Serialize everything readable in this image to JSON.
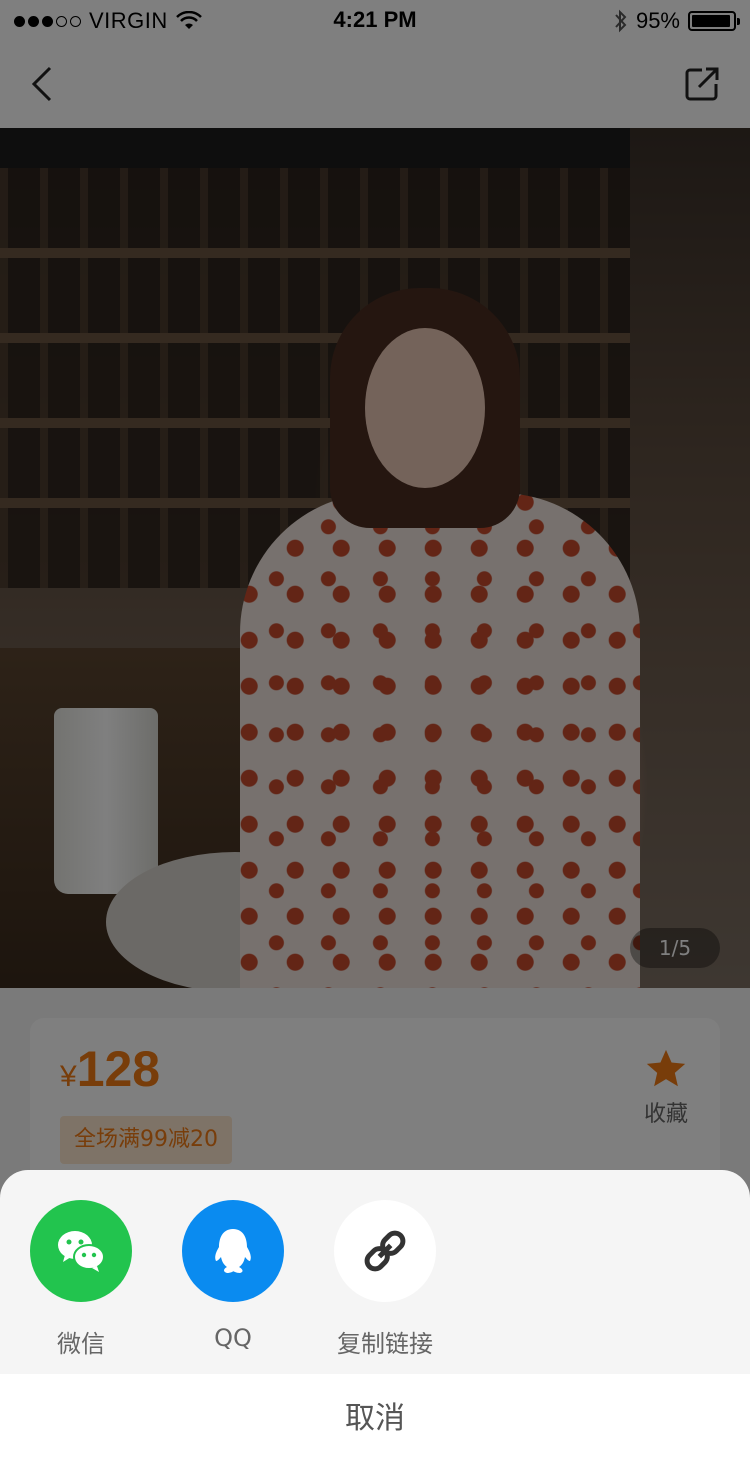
{
  "status_bar": {
    "carrier": "VIRGIN",
    "time": "4:21 PM",
    "battery": "95%",
    "battery_level": 0.95
  },
  "nav": {
    "back_icon": "chevron-left-icon",
    "share_icon": "share-external-icon"
  },
  "product": {
    "image_counter": "1/5",
    "price_symbol": "¥",
    "price": "128",
    "promo": "全场满99减20",
    "favorite_label": "收藏",
    "accent_color": "#f07a14"
  },
  "share_sheet": {
    "options": [
      {
        "label": "微信",
        "icon": "wechat-icon",
        "color": "#22c44e"
      },
      {
        "label": "QQ",
        "icon": "qq-icon",
        "color": "#0a8bf0"
      },
      {
        "label": "复制链接",
        "icon": "link-icon",
        "color": "#ffffff"
      }
    ],
    "cancel_label": "取消"
  }
}
